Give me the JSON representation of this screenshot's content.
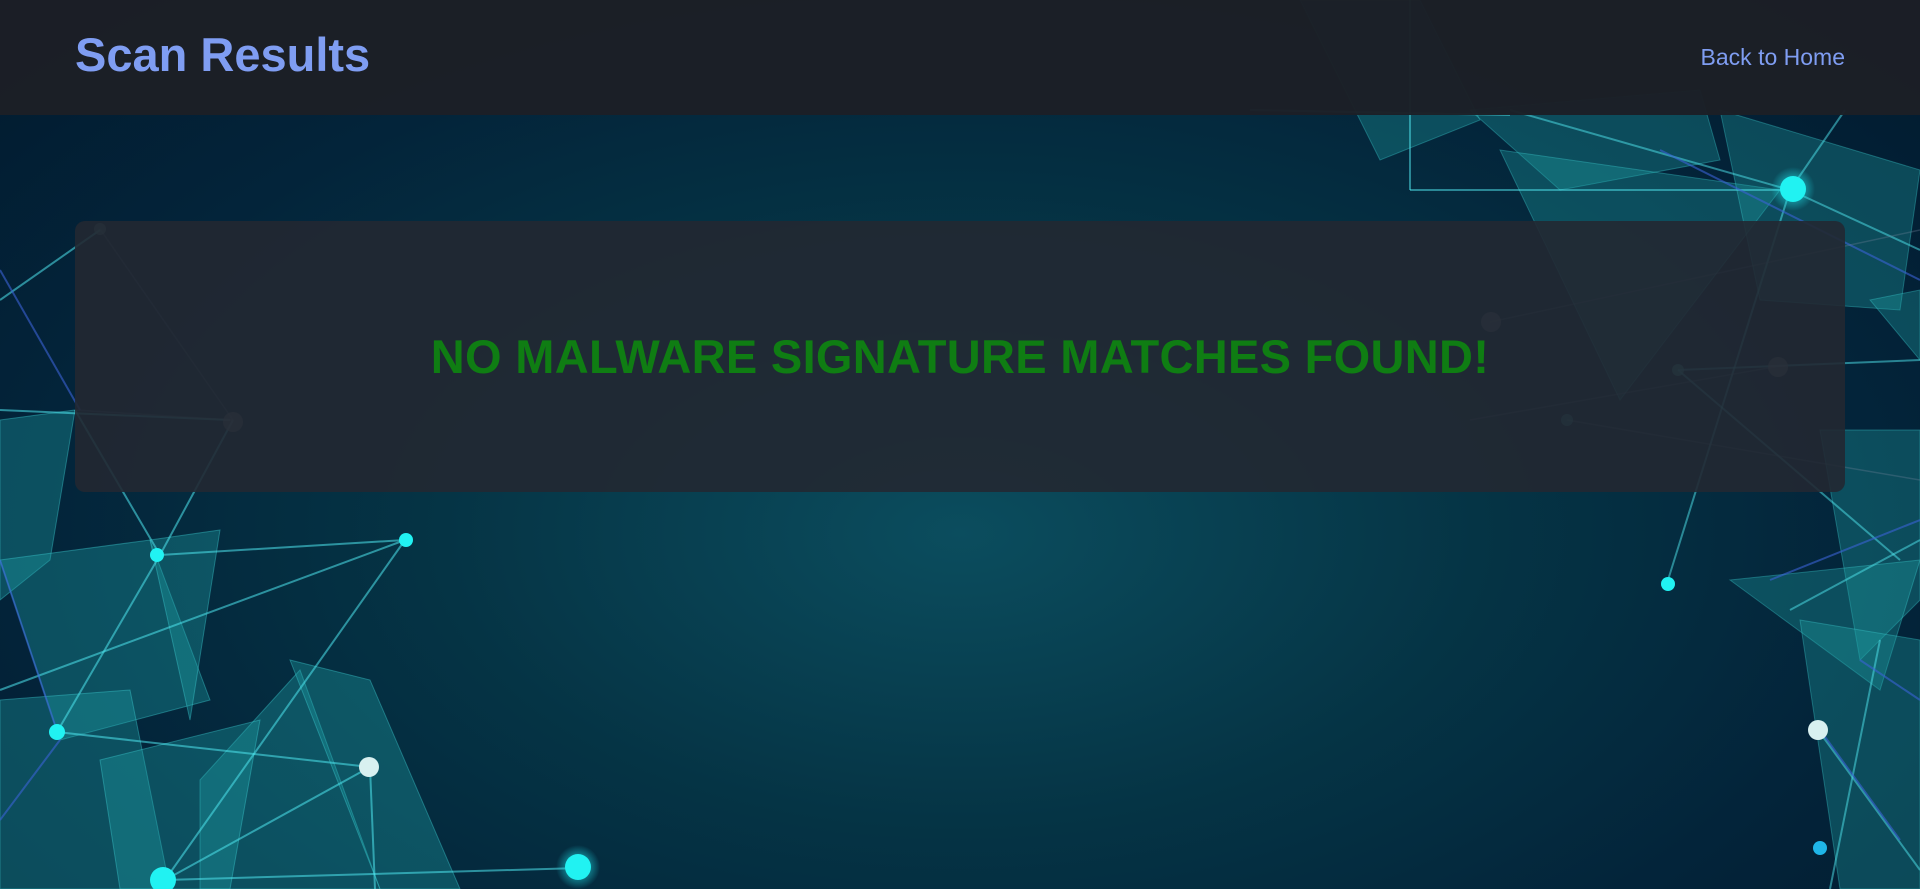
{
  "header": {
    "title": "Scan Results",
    "back_link_label": "Back to Home"
  },
  "result": {
    "message": "NO MALWARE SIGNATURE MATCHES FOUND!",
    "color": "#0f7d13"
  },
  "theme": {
    "accent": "#7f9df2",
    "header_background": "#1c1f26",
    "card_background": "#222832"
  }
}
